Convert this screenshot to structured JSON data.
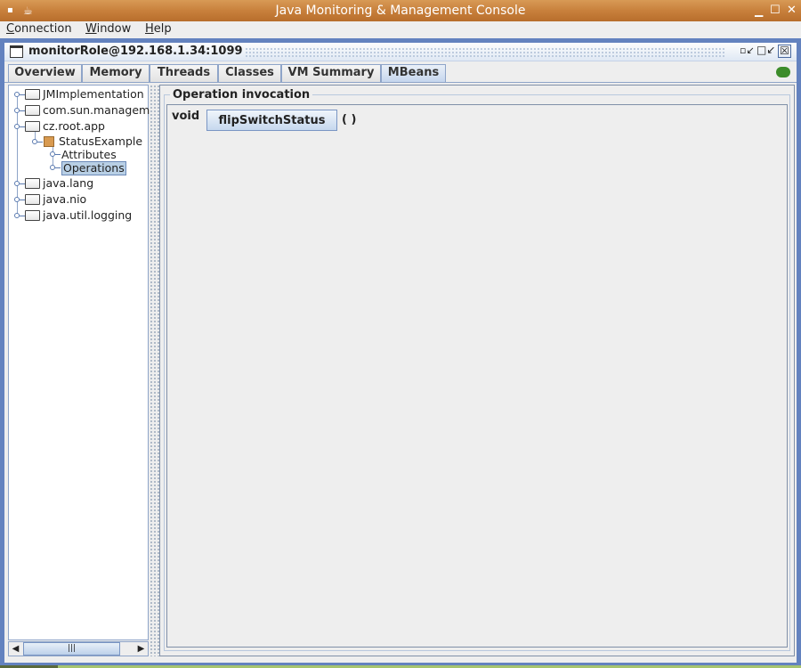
{
  "window": {
    "title": "Java Monitoring & Management Console"
  },
  "menu": [
    {
      "label": "Connection",
      "mnemonic": "C",
      "rest": "onnection"
    },
    {
      "label": "Window",
      "mnemonic": "W",
      "rest": "indow"
    },
    {
      "label": "Help",
      "mnemonic": "H",
      "rest": "elp"
    }
  ],
  "connection": {
    "title": "monitorRole@192.168.1.34:1099"
  },
  "tabs": [
    "Overview",
    "Memory",
    "Threads",
    "Classes",
    "VM Summary",
    "MBeans"
  ],
  "active_tab": "MBeans",
  "tree": [
    {
      "label": "JMImplementation"
    },
    {
      "label": "com.sun.managem"
    },
    {
      "label": "cz.root.app"
    },
    {
      "label": "StatusExample"
    },
    {
      "label": "Attributes"
    },
    {
      "label": "Operations",
      "selected": true
    },
    {
      "label": "java.lang"
    },
    {
      "label": "java.nio"
    },
    {
      "label": "java.util.logging"
    }
  ],
  "operation": {
    "group_title": "Operation invocation",
    "return_type": "void",
    "name": "flipSwitchStatus",
    "params": "( )"
  },
  "colors": {
    "frame": "#6382bf",
    "selection": "#b8cfe5",
    "connected": "#3c8c2a"
  }
}
